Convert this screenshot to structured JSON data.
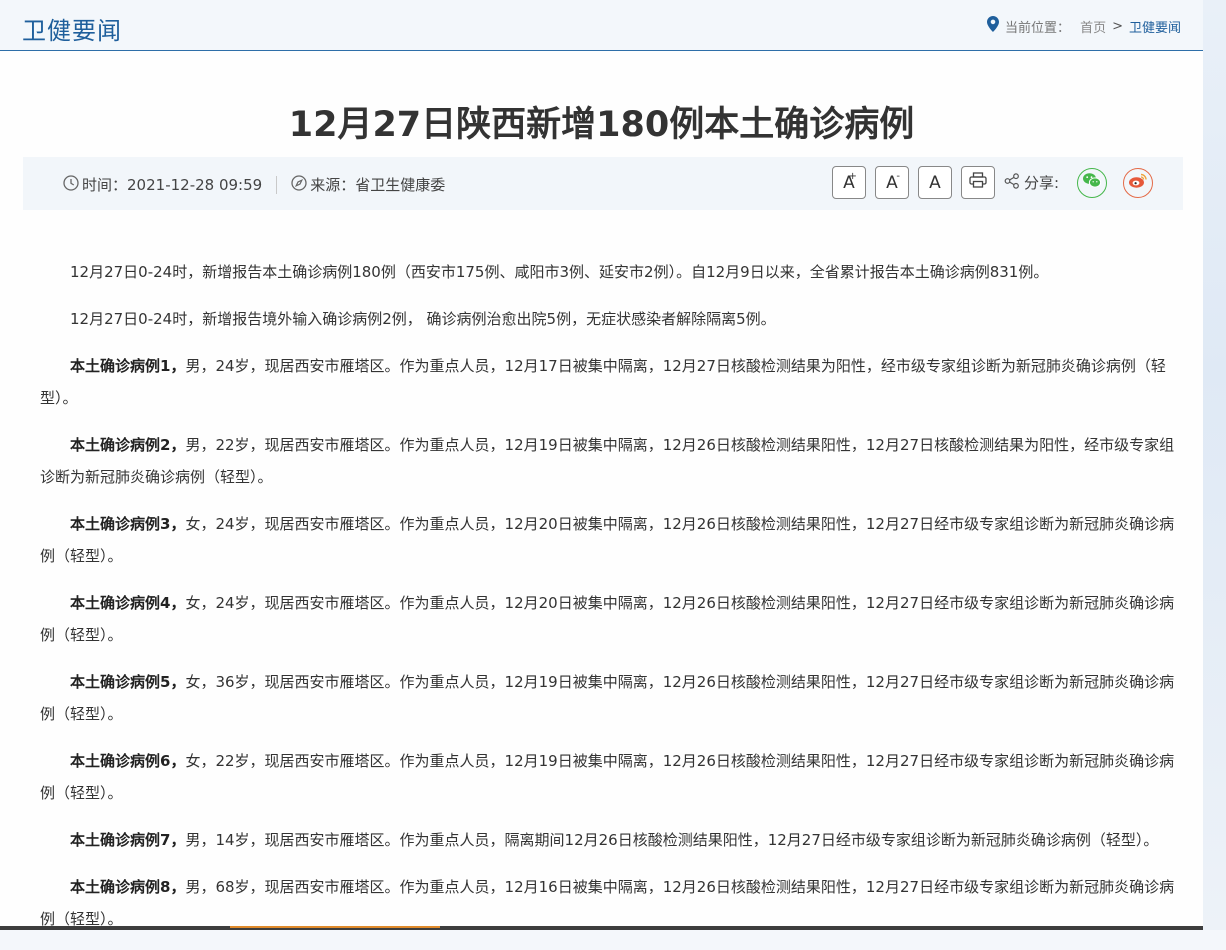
{
  "header": {
    "section_title": "卫健要闻",
    "breadcrumb_label": "当前位置：",
    "breadcrumb_home": "首页",
    "breadcrumb_sep": ">",
    "breadcrumb_current": "卫健要闻"
  },
  "article": {
    "title": "12月27日陕西新增180例本土确诊病例",
    "time_label": "时间：",
    "time_value": "2021-12-28 09:59",
    "source_label": "来源：",
    "source_value": "省卫生健康委"
  },
  "toolbar": {
    "font_larger": "A",
    "font_smaller": "A",
    "font_default": "A",
    "share_label": "分享:"
  },
  "paragraphs": [
    {
      "lead": "",
      "text": "12月27日0-24时，新增报告本土确诊病例180例（西安市175例、咸阳市3例、延安市2例）。自12月9日以来，全省累计报告本土确诊病例831例。"
    },
    {
      "lead": "",
      "text": "12月27日0-24时，新增报告境外输入确诊病例2例， 确诊病例治愈出院5例，无症状感染者解除隔离5例。"
    },
    {
      "lead": "本土确诊病例1，",
      "text": "男，24岁，现居西安市雁塔区。作为重点人员，12月17日被集中隔离，12月27日核酸检测结果为阳性，经市级专家组诊断为新冠肺炎确诊病例（轻型）。"
    },
    {
      "lead": "本土确诊病例2，",
      "text": "男，22岁，现居西安市雁塔区。作为重点人员，12月19日被集中隔离，12月26日核酸检测结果阳性，12月27日核酸检测结果为阳性，经市级专家组诊断为新冠肺炎确诊病例（轻型）。"
    },
    {
      "lead": "本土确诊病例3，",
      "text": "女，24岁，现居西安市雁塔区。作为重点人员，12月20日被集中隔离，12月26日核酸检测结果阳性，12月27日经市级专家组诊断为新冠肺炎确诊病例（轻型）。"
    },
    {
      "lead": "本土确诊病例4，",
      "text": "女，24岁，现居西安市雁塔区。作为重点人员，12月20日被集中隔离，12月26日核酸检测结果阳性，12月27日经市级专家组诊断为新冠肺炎确诊病例（轻型）。"
    },
    {
      "lead": "本土确诊病例5，",
      "text": "女，36岁，现居西安市雁塔区。作为重点人员，12月19日被集中隔离，12月26日核酸检测结果阳性，12月27日经市级专家组诊断为新冠肺炎确诊病例（轻型）。"
    },
    {
      "lead": "本土确诊病例6，",
      "text": "女，22岁，现居西安市雁塔区。作为重点人员，12月19日被集中隔离，12月26日核酸检测结果阳性，12月27日经市级专家组诊断为新冠肺炎确诊病例（轻型）。"
    },
    {
      "lead": "本土确诊病例7，",
      "text": "男，14岁，现居西安市雁塔区。作为重点人员，隔离期间12月26日核酸检测结果阳性，12月27日经市级专家组诊断为新冠肺炎确诊病例（轻型）。"
    },
    {
      "lead": "本土确诊病例8，",
      "text": "男，68岁，现居西安市雁塔区。作为重点人员，12月16日被集中隔离，12月26日核酸检测结果阳性，12月27日经市级专家组诊断为新冠肺炎确诊病例（轻型）。"
    }
  ]
}
